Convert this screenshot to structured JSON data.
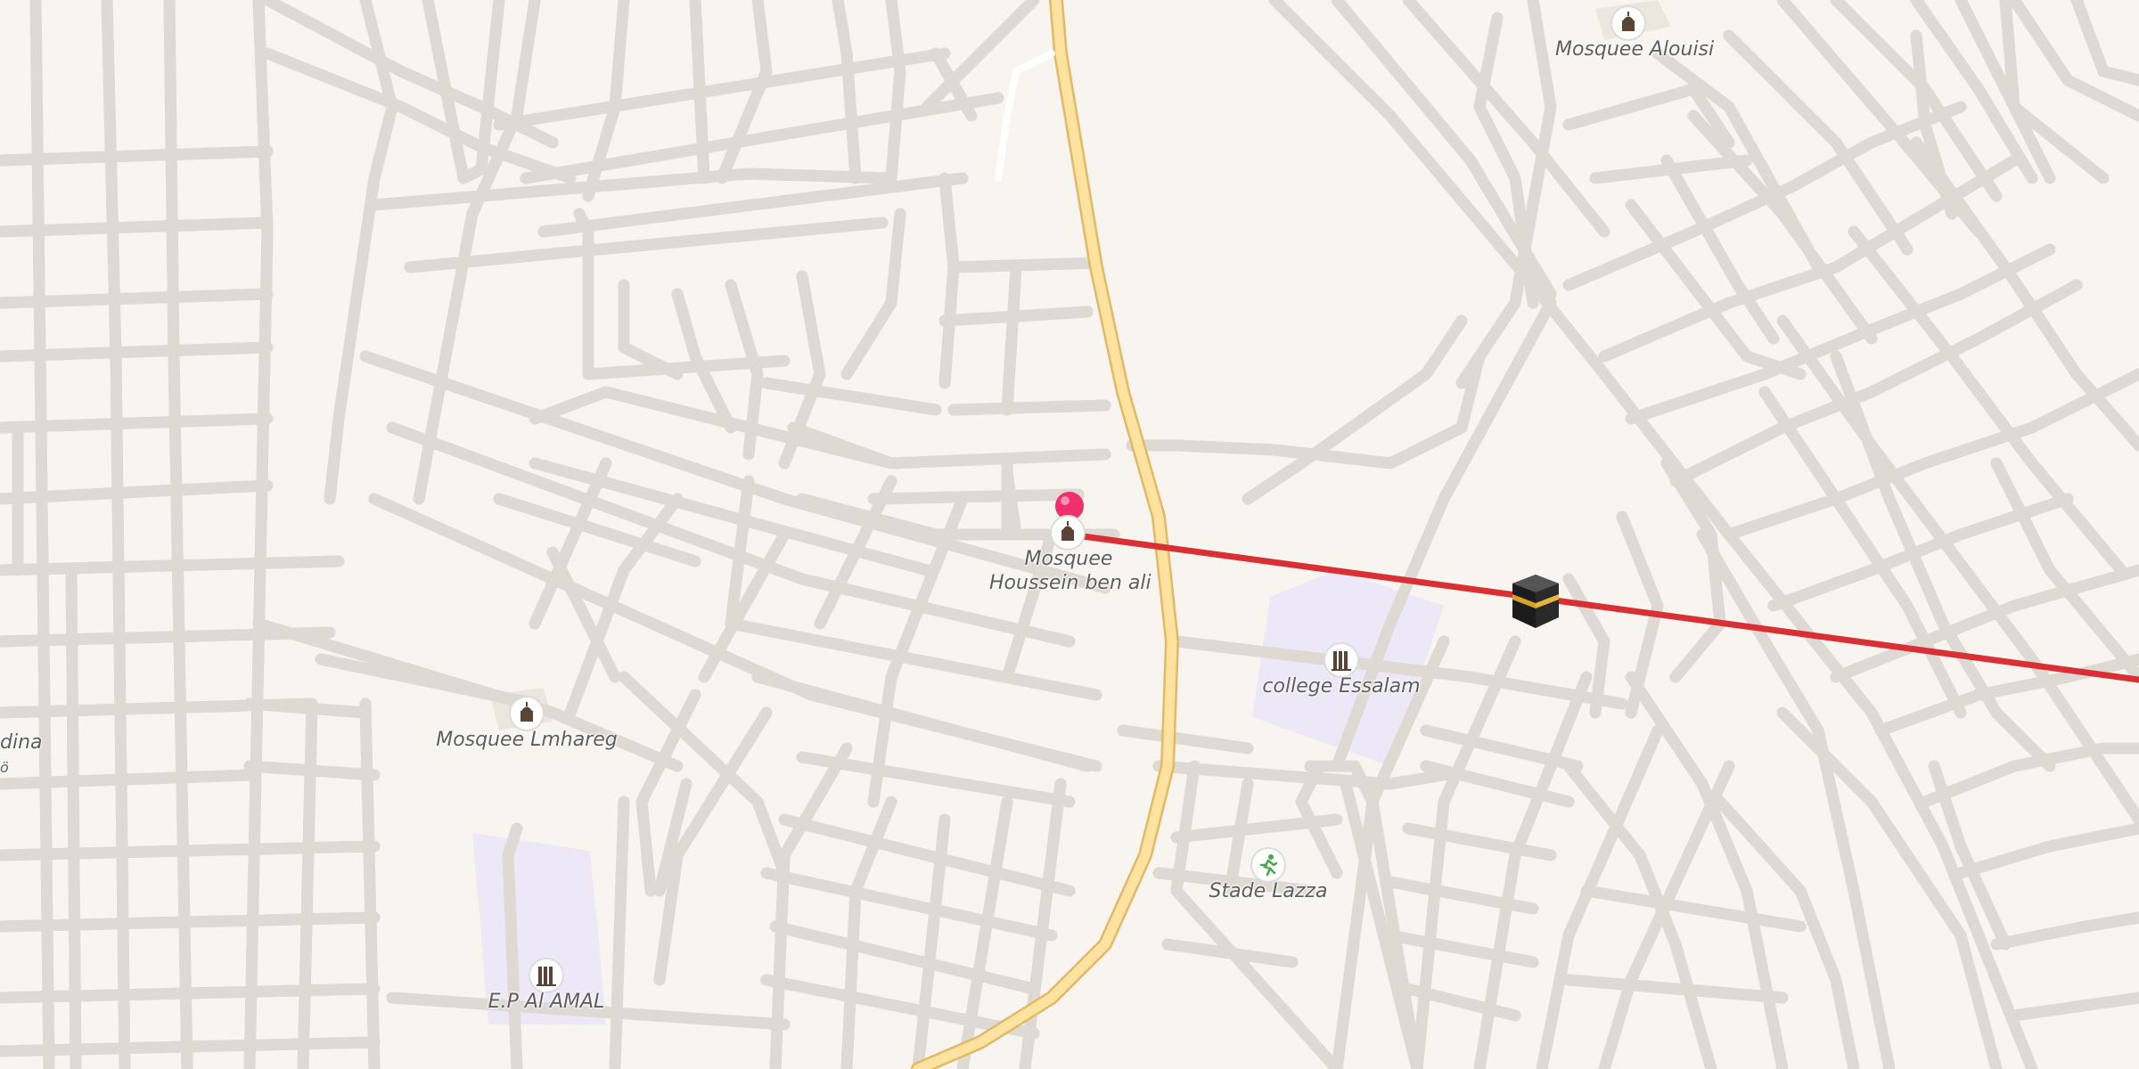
{
  "map": {
    "colors": {
      "background": "#f8f5f1",
      "minor_road": "#ffffff",
      "minor_road_casing": "#dedad3",
      "main_road": "#fde39f",
      "main_road_casing": "#e3b868",
      "school_area": "#ece8f7",
      "qibla_line": "#d93035",
      "pin": "#f0306e",
      "icon_brown": "#5b4336",
      "icon_green": "#4aa84a"
    },
    "pois": [
      {
        "id": "mosquee-alouisi",
        "icon": "mosque-icon",
        "label_lines": [
          "Mosquee Alouisi"
        ]
      },
      {
        "id": "mosquee-houssein-ben-ali",
        "icon": "mosque-icon",
        "label_lines": [
          "Mosquee",
          "Houssein ben ali"
        ]
      },
      {
        "id": "college-essalam",
        "icon": "school-icon",
        "label_lines": [
          "college Essalam"
        ]
      },
      {
        "id": "mosquee-lmhareg",
        "icon": "mosque-icon",
        "label_lines": [
          "Mosquee Lmhareg"
        ]
      },
      {
        "id": "stade-lazza",
        "icon": "stadium-runner-icon",
        "label_lines": [
          "Stade Lazza"
        ]
      },
      {
        "id": "ep-al-amal",
        "icon": "school-icon",
        "label_lines": [
          "E.P Al AMAL"
        ]
      }
    ],
    "edge_labels": {
      "left_partial_1": "dina",
      "left_partial_2": "ö"
    },
    "location_pin": {
      "icon": "location-pin-icon"
    },
    "qibla_marker": {
      "icon": "kaaba-icon"
    }
  }
}
